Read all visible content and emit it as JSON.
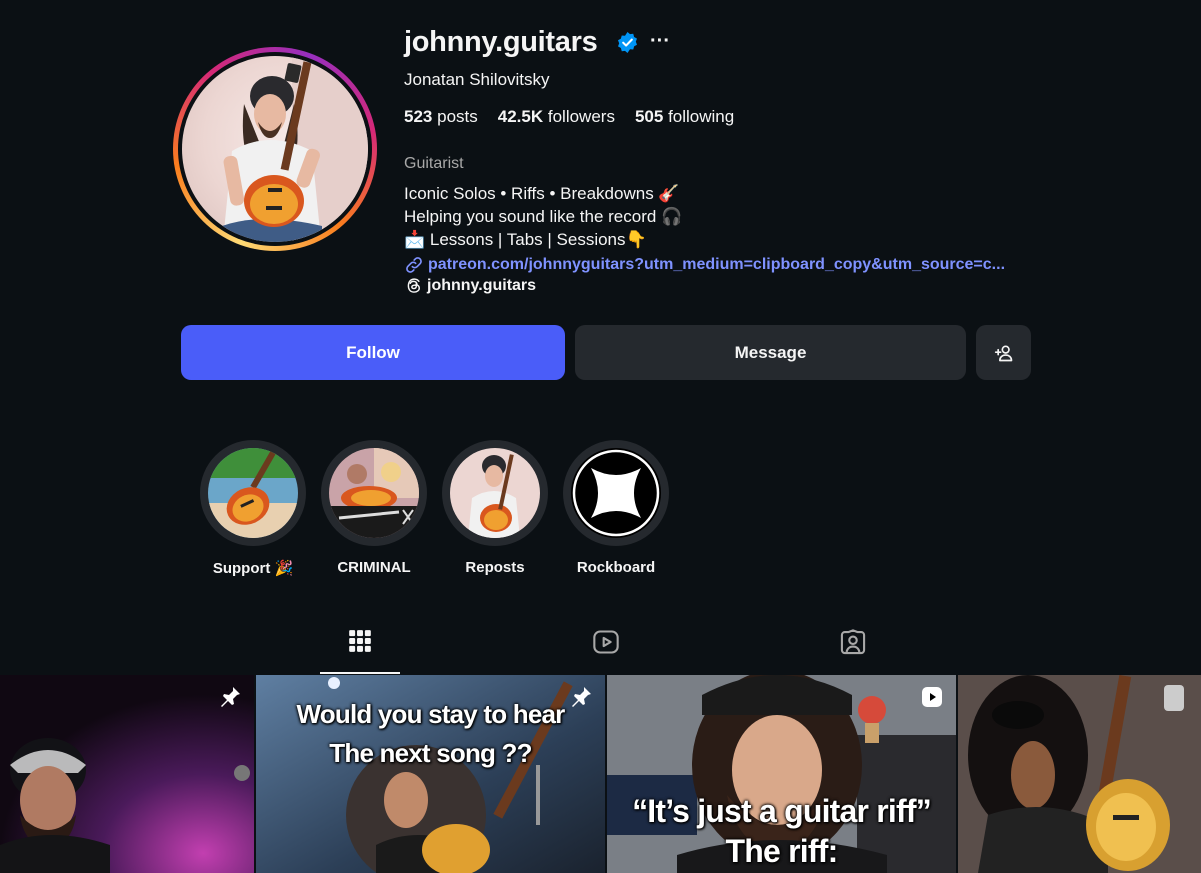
{
  "profile": {
    "username": "johnny.guitars",
    "full_name": "Jonatan Shilovitsky",
    "stats": {
      "posts_count": "523",
      "posts_label": "posts",
      "followers_count": "42.5K",
      "followers_label": "followers",
      "following_count": "505",
      "following_label": "following"
    },
    "category": "Guitarist",
    "bio_lines": [
      "Iconic Solos • Riffs • Breakdowns 🎸",
      "Helping you sound like the record 🎧",
      "📩 Lessons | Tabs | Sessions👇"
    ],
    "link": "patreon.com/johnnyguitars?utm_medium=clipboard_copy&utm_source=c...",
    "threads_handle": "johnny.guitars"
  },
  "actions": {
    "follow_label": "Follow",
    "message_label": "Message"
  },
  "highlights": [
    {
      "label": "Support 🎉"
    },
    {
      "label": "CRIMINAL"
    },
    {
      "label": "Reposts"
    },
    {
      "label": "Rockboard"
    }
  ],
  "posts": [
    {
      "caption": ""
    },
    {
      "caption_line1": "Would you stay to hear",
      "caption_line2": "The next song ??"
    },
    {
      "caption_line1": "“It’s just a guitar riff”",
      "caption_line2": "The riff:"
    },
    {
      "caption": ""
    }
  ],
  "icons": {
    "verified": "verified-badge-icon",
    "more": "more-options-icon",
    "link": "link-icon",
    "threads": "threads-icon",
    "add_user": "add-user-icon",
    "grid": "grid-icon",
    "reels": "reels-icon",
    "tagged": "tagged-icon",
    "pin": "pin-icon",
    "reel_badge": "reel-badge-icon"
  },
  "colors": {
    "background": "#0b1014",
    "follow_button": "#4a5df9",
    "secondary_button": "#25292e",
    "link": "#7f92ff",
    "verified": "#0095f6"
  }
}
